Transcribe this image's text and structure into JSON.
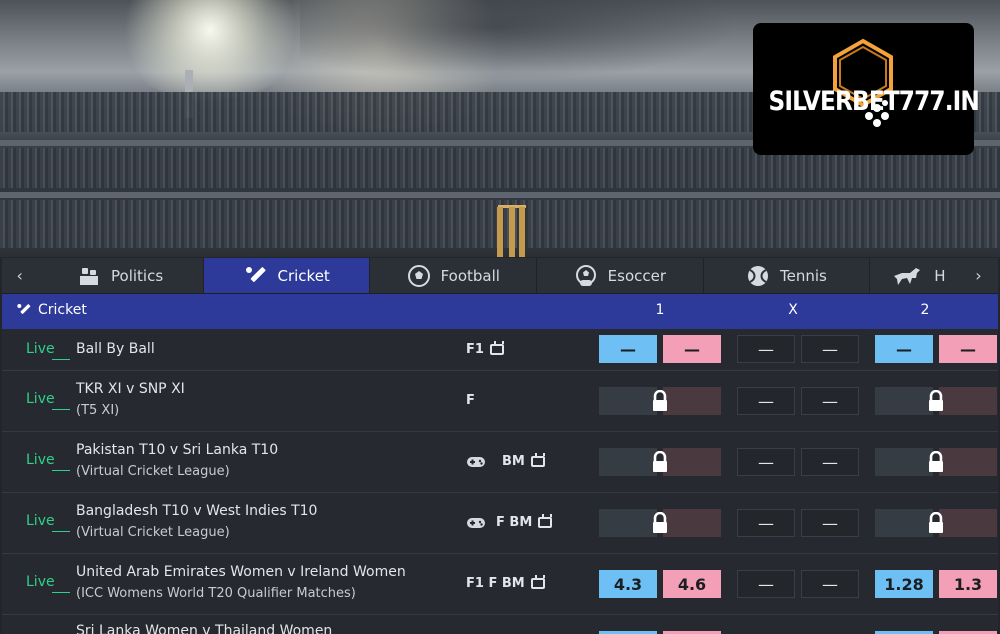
{
  "logo": {
    "text": "SILVERBET777.IN"
  },
  "tabs": {
    "prev_arrow": "‹",
    "next_arrow": "›",
    "items": [
      {
        "label": "Politics",
        "icon": "politics-icon"
      },
      {
        "label": "Cricket",
        "icon": "cricket-bat-icon",
        "active": true
      },
      {
        "label": "Football",
        "icon": "football-icon"
      },
      {
        "label": "Esoccer",
        "icon": "esoccer-icon"
      },
      {
        "label": "Tennis",
        "icon": "tennis-ball-icon"
      },
      {
        "label": "H",
        "icon": "horse-racing-icon"
      }
    ]
  },
  "section": {
    "title": "Cricket",
    "col1": "1",
    "colx": "X",
    "col2": "2"
  },
  "colors": {
    "accent": "#2d3a9a",
    "live": "#2fd08a",
    "back": "#6ec0f4",
    "lay": "#f49fb8"
  },
  "rows": [
    {
      "live": "Live",
      "name": "Ball By Ball",
      "sub": "",
      "badges": "F1",
      "odds": [
        "—",
        "—",
        "—",
        "—",
        "—",
        "—"
      ]
    },
    {
      "live": "Live",
      "name": "TKR XI v SNP XI",
      "sub": "(T5 XI)",
      "badges": "F",
      "odds": [
        "",
        "",
        "—",
        "—",
        "",
        ""
      ]
    },
    {
      "live": "Live",
      "name": "Pakistan T10 v Sri Lanka T10",
      "sub": "(Virtual Cricket League)",
      "badges": "BM",
      "odds": [
        "",
        "",
        "—",
        "—",
        "",
        ""
      ]
    },
    {
      "live": "Live",
      "name": "Bangladesh T10 v West Indies T10",
      "sub": "(Virtual Cricket League)",
      "badges": "F BM",
      "odds": [
        "",
        "",
        "—",
        "—",
        "",
        ""
      ]
    },
    {
      "live": "Live",
      "name": "United Arab Emirates Women v Ireland Women",
      "sub": "(ICC Womens World T20 Qualifier Matches)",
      "badges": "F1 F BM",
      "odds": [
        "4.3",
        "4.6",
        "—",
        "—",
        "1.28",
        "1.3"
      ]
    },
    {
      "live": "",
      "name": "Sri Lanka Women v Thailand Women",
      "sub": "",
      "badges": "",
      "odds": [
        "",
        "",
        "",
        "",
        "",
        ""
      ]
    }
  ]
}
